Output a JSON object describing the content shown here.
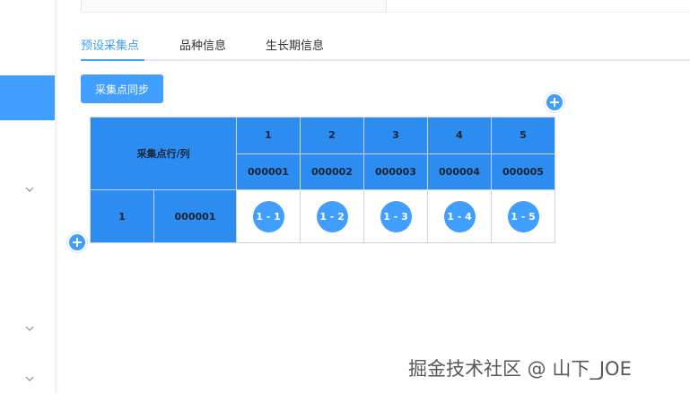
{
  "tabs": [
    {
      "label": "预设采集点",
      "active": true
    },
    {
      "label": "品种信息",
      "active": false
    },
    {
      "label": "生长期信息",
      "active": false
    }
  ],
  "sync_button": {
    "label": "采集点同步"
  },
  "grid": {
    "corner_label": "采集点行/列",
    "columns": [
      {
        "index": "1",
        "code": "000001"
      },
      {
        "index": "2",
        "code": "000002"
      },
      {
        "index": "3",
        "code": "000003"
      },
      {
        "index": "4",
        "code": "000004"
      },
      {
        "index": "5",
        "code": "000005"
      }
    ],
    "rows": [
      {
        "index": "1",
        "code": "000001",
        "points": [
          "1 - 1",
          "1 - 2",
          "1 - 3",
          "1 - 4",
          "1 - 5"
        ]
      }
    ]
  },
  "icons": {
    "add_column": "plus-icon",
    "add_row": "plus-icon",
    "sidebar_expand": "chevron-down-icon"
  },
  "colors": {
    "accent": "#409eff",
    "header_fill": "#2d8cf0",
    "border": "#cfd6df"
  },
  "watermark": "掘金技术社区 @ 山下_JOE"
}
